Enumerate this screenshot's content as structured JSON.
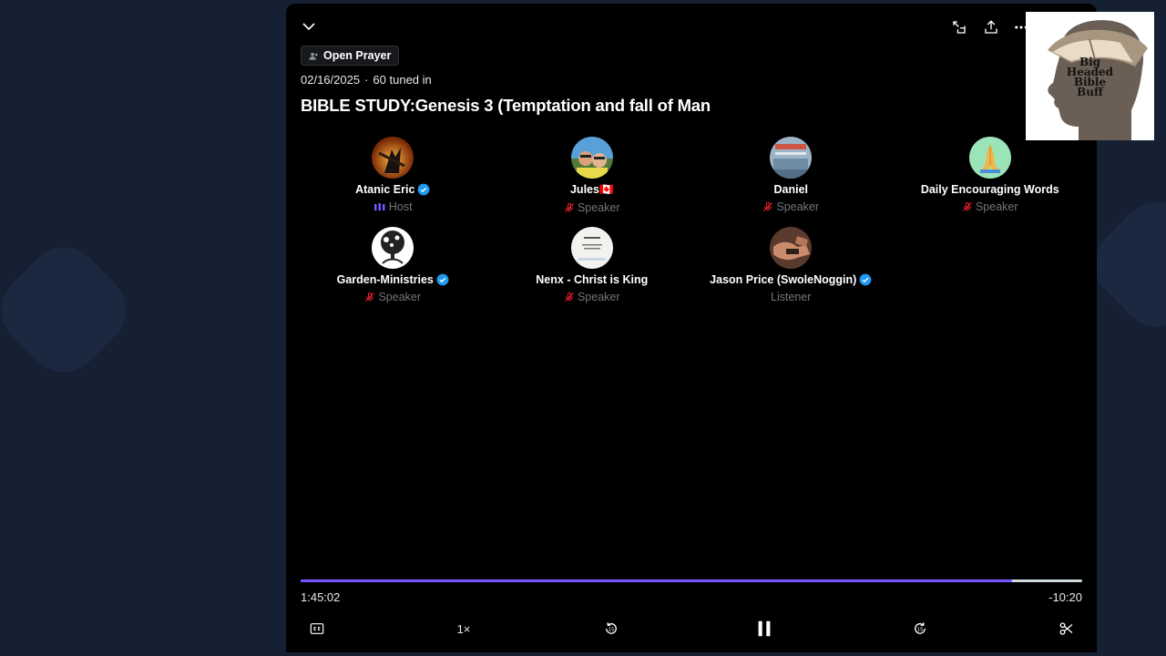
{
  "space": {
    "topic": "Open Prayer",
    "date": "02/16/2025",
    "separator": "·",
    "tuned_in": "60 tuned in",
    "title": "BIBLE STUDY:Genesis 3 (Temptation and fall of Man"
  },
  "participants": [
    {
      "name": "Atanic Eric",
      "verified": true,
      "role": "Host",
      "role_icon": "speaking-bars-icon",
      "avatar": "fire-warrior"
    },
    {
      "name": "Jules🇨🇦",
      "verified": false,
      "role": "Speaker",
      "role_icon": "mic-muted-icon",
      "avatar": "couple-photo"
    },
    {
      "name": "Daniel",
      "verified": false,
      "role": "Speaker",
      "role_icon": "mic-muted-icon",
      "avatar": "poster"
    },
    {
      "name": "Daily Encouraging Words",
      "verified": false,
      "role": "Speaker",
      "role_icon": "mic-muted-icon",
      "avatar": "praying-hands"
    },
    {
      "name": "Garden-Ministries",
      "verified": true,
      "role": "Speaker",
      "role_icon": "mic-muted-icon",
      "avatar": "tree"
    },
    {
      "name": "Nenx - Christ is King",
      "verified": false,
      "role": "Speaker",
      "role_icon": "mic-muted-icon",
      "avatar": "note"
    },
    {
      "name": "Jason Price (SwoleNoggin)",
      "verified": true,
      "role": "Listener",
      "role_icon": "",
      "avatar": "hands"
    }
  ],
  "playback": {
    "elapsed": "1:45:02",
    "remaining": "-10:20",
    "progress_fraction": 0.91,
    "speed": "1×"
  },
  "thumbnail": {
    "lines": [
      "Big",
      "Headed",
      "Bible",
      "Buff"
    ]
  },
  "colors": {
    "accent": "#7856ff",
    "verified": "#1d9bf0",
    "muted_mic": "#f4212e",
    "background": "#152033"
  }
}
